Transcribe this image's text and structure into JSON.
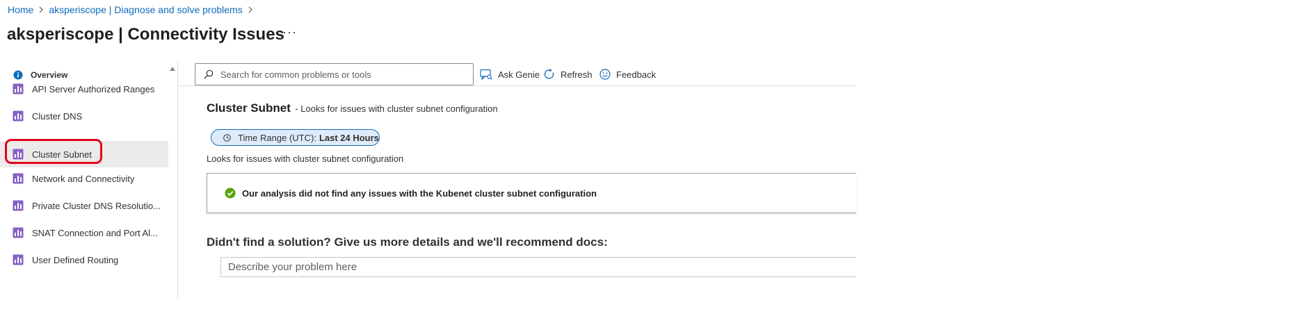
{
  "breadcrumb": {
    "items": [
      "Home",
      "aksperiscope | Diagnose and solve problems"
    ]
  },
  "page": {
    "title": "aksperiscope | Connectivity Issues",
    "more": "···"
  },
  "sidebar": {
    "items": [
      {
        "label": "Overview",
        "icon": "info-icon"
      },
      {
        "label": "API Server Authorized Ranges",
        "icon": "report-chart-icon"
      },
      {
        "label": "Cluster DNS",
        "icon": "report-chart-icon"
      },
      {
        "label": "Cluster Subnet",
        "icon": "report-chart-icon",
        "selected": true
      },
      {
        "label": "Network and Connectivity",
        "icon": "report-chart-icon"
      },
      {
        "label": "Private Cluster DNS Resolutio...",
        "icon": "report-chart-icon"
      },
      {
        "label": "SNAT Connection and Port Al...",
        "icon": "report-chart-icon"
      },
      {
        "label": "User Defined Routing",
        "icon": "report-chart-icon"
      }
    ]
  },
  "toolbar": {
    "search_placeholder": "Search for common problems or tools",
    "ask_genie": "Ask Genie",
    "refresh": "Refresh",
    "feedback": "Feedback"
  },
  "content": {
    "heading": "Cluster Subnet",
    "heading_desc": "- Looks for issues with cluster subnet configuration",
    "time_range_label": "Time Range (UTC):",
    "time_range_value": "Last 24 Hours",
    "description": "Looks for issues with cluster subnet configuration",
    "result_message": "Our analysis did not find any issues with the Kubenet cluster subnet configuration",
    "help_title": "Didn't find a solution? Give us more details and we'll recommend docs:",
    "help_placeholder": "Describe your problem here"
  },
  "colors": {
    "link": "#0f6cbd",
    "selected_bg": "#edebe9",
    "highlight": "#e3001b",
    "success": "#57a300",
    "icon_purple": "#8661c5"
  }
}
